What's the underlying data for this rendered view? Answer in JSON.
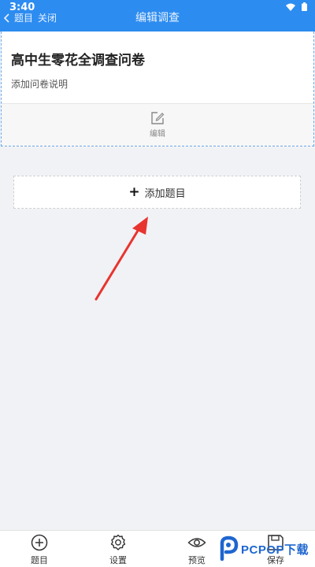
{
  "status": {
    "time": "3:40"
  },
  "header": {
    "back_label": "题目",
    "close_label": "关闭",
    "title": "编辑调查"
  },
  "survey": {
    "title": "高中生零花全调查问卷",
    "description_placeholder": "添加问卷说明",
    "edit_label": "编辑"
  },
  "add_question": {
    "label": "添加题目"
  },
  "tabbar": {
    "items": [
      {
        "label": "题目",
        "icon": "plus-circle-icon"
      },
      {
        "label": "设置",
        "icon": "gear-icon"
      },
      {
        "label": "预览",
        "icon": "eye-icon"
      },
      {
        "label": "保存",
        "icon": "save-icon"
      }
    ]
  },
  "watermark": {
    "text": "PCPOP下载"
  },
  "colors": {
    "accent": "#2d8cf0",
    "annotation": "#e8342e"
  }
}
